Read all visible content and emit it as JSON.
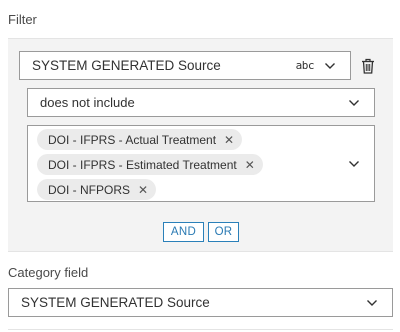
{
  "filter": {
    "label": "Filter",
    "field_select": {
      "value": "SYSTEM GENERATED Source",
      "type_badge": "abc"
    },
    "delete_icon": "trash-icon",
    "operator_select": {
      "value": "does not include"
    },
    "values": [
      {
        "label": "DOI - IFPRS - Actual Treatment"
      },
      {
        "label": "DOI - IFPRS - Estimated Treatment"
      },
      {
        "label": "DOI - NFPORS"
      }
    ],
    "chip_remove_glyph": "✕",
    "logic": {
      "and_label": "AND",
      "or_label": "OR"
    }
  },
  "category": {
    "label": "Category field",
    "select": {
      "value": "SYSTEM GENERATED Source"
    }
  },
  "colors": {
    "accent": "#2a7ab3",
    "panel_background": "#f3f3f3",
    "chip_background": "#ebebeb",
    "border": "#9a9a9a"
  }
}
